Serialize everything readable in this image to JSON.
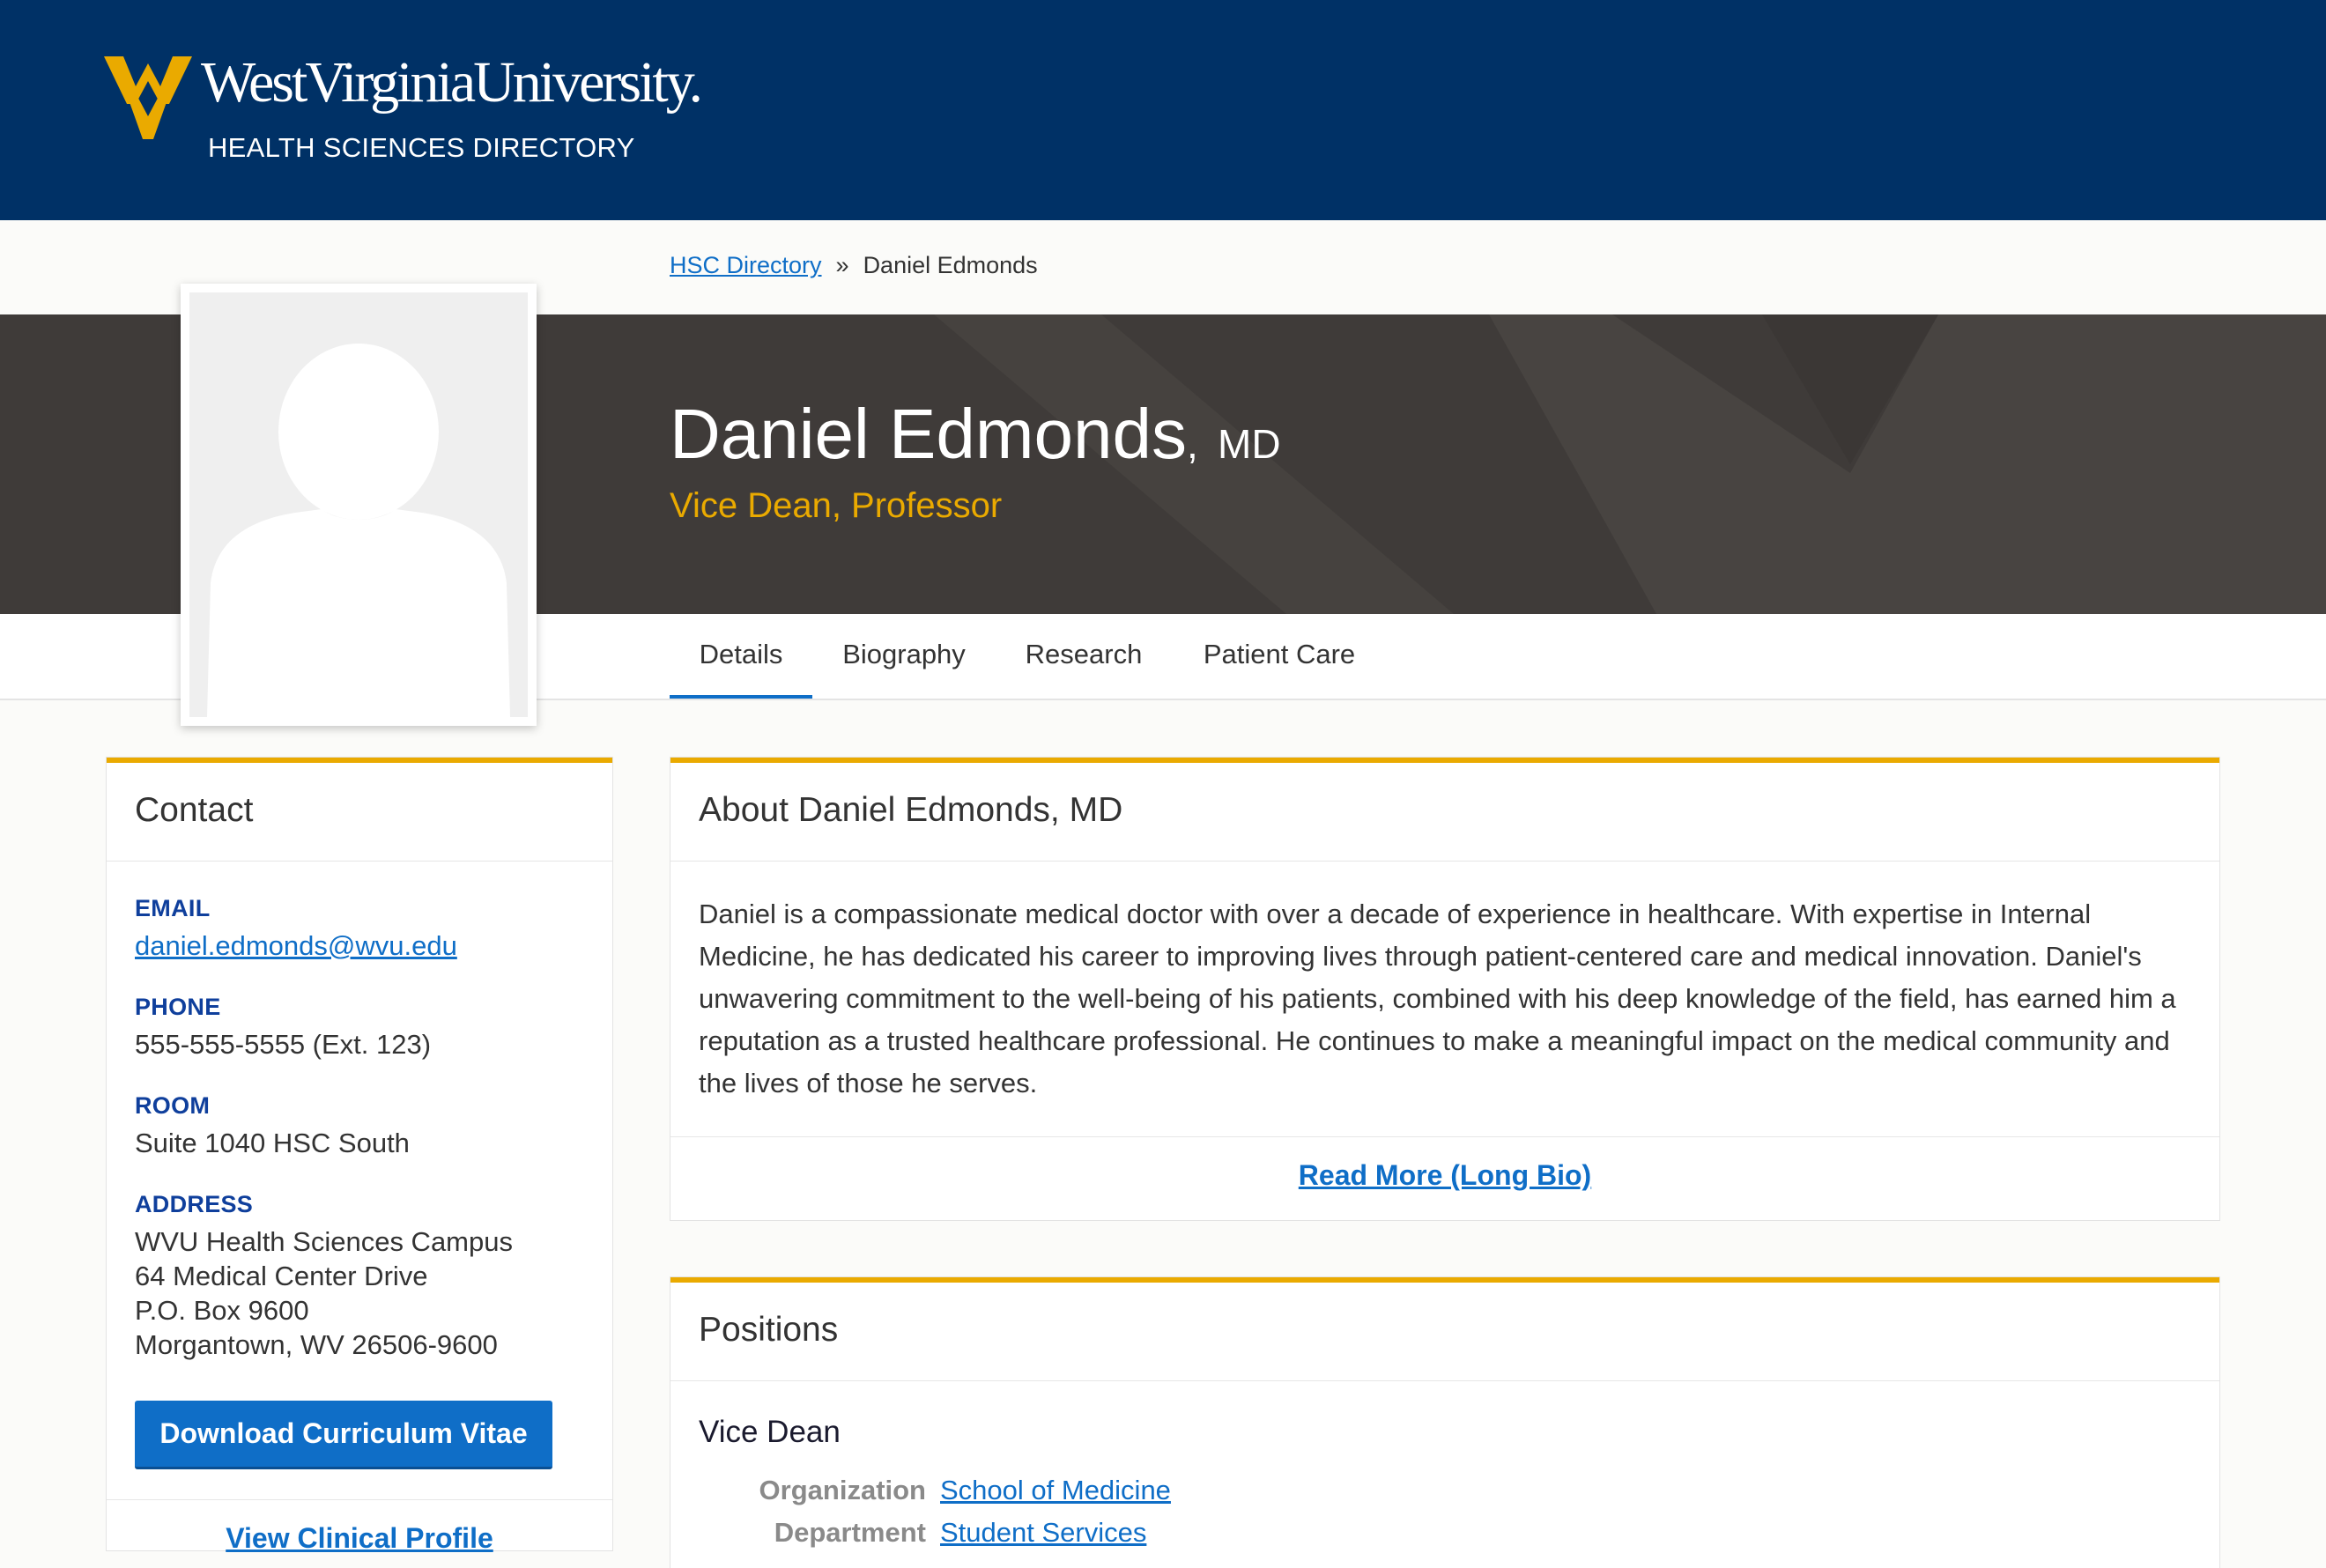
{
  "header": {
    "wordmark": "WestVirginiaUniversity.",
    "subtitle": "HEALTH SCIENCES DIRECTORY"
  },
  "breadcrumb": {
    "root": "HSC Directory",
    "separator": "»",
    "current": "Daniel Edmonds"
  },
  "profile": {
    "name": "Daniel Edmonds",
    "credential_sep": ",",
    "credential": "MD",
    "title": "Vice Dean, Professor"
  },
  "tabs": [
    {
      "label": "Details",
      "active": true
    },
    {
      "label": "Biography",
      "active": false
    },
    {
      "label": "Research",
      "active": false
    },
    {
      "label": "Patient Care",
      "active": false
    }
  ],
  "contact": {
    "heading": "Contact",
    "email_label": "EMAIL",
    "email": "daniel.edmonds@wvu.edu",
    "phone_label": "PHONE",
    "phone": "555-555-5555 (Ext. 123)",
    "room_label": "ROOM",
    "room": "Suite 1040 HSC South",
    "address_label": "ADDRESS",
    "address_lines": [
      "WVU Health Sciences Campus",
      "64 Medical Center Drive",
      "P.O. Box 9600",
      "Morgantown, WV 26506-9600"
    ],
    "download_button": "Download Curriculum Vitae",
    "clinical_link": "View Clinical Profile"
  },
  "about": {
    "heading": "About Daniel Edmonds, MD",
    "body": "Daniel is a compassionate medical doctor with over a decade of experience in healthcare. With expertise in Internal Medicine, he has dedicated his career to improving lives through patient-centered care and medical innovation. Daniel's unwavering commitment to the well-being of his patients, combined with his deep knowledge of the field, has earned him a reputation as a trusted healthcare professional. He continues to make a meaningful impact on the medical community and the lives of those he serves.",
    "read_more": "Read More (Long Bio)"
  },
  "positions": {
    "heading": "Positions",
    "items": [
      {
        "title": "Vice Dean",
        "organization_label": "Organization",
        "organization": "School of Medicine",
        "department_label": "Department",
        "department": "Student Services"
      }
    ]
  },
  "colors": {
    "navy": "#003166",
    "gold": "#eaaa00",
    "link_blue": "#0f6ec7",
    "hero_gray": "#3f3b39"
  }
}
